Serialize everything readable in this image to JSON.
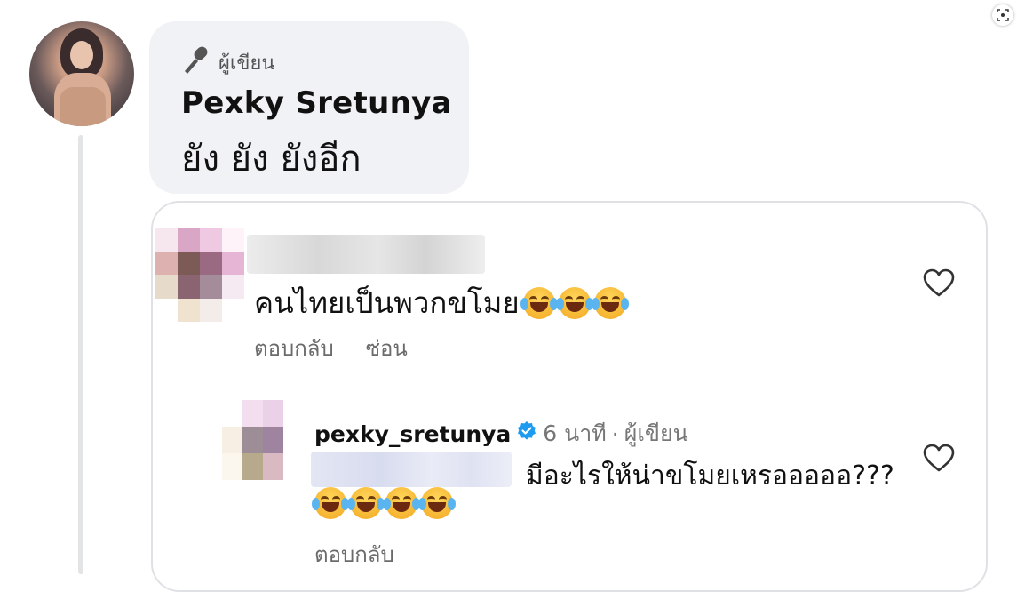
{
  "post": {
    "author_badge": "ผู้เขียน",
    "author_name": "Pexky Sretunya",
    "text": "ยัง ยัง ยังอีก"
  },
  "comment": {
    "text": "คนไทยเป็นพวกขโมย",
    "emoji_count": 3,
    "actions": {
      "reply": "ตอบกลับ",
      "hide": "ซ่อน"
    }
  },
  "reply": {
    "username": "pexky_sretunya",
    "time": "6 นาที",
    "separator": "·",
    "badge": "ผู้เขียน",
    "text": "มีอะไรให้น่าขโมยเหรอออออ???",
    "emoji_count": 4,
    "actions": {
      "reply": "ตอบกลับ"
    }
  },
  "icons": {
    "screenshot": "screenshot-scan-icon",
    "author": "microphone-icon",
    "verified": "verified-badge-icon",
    "like": "heart-outline-icon",
    "emoji": "face-with-tears-of-joy-emoji"
  },
  "colors": {
    "bubble": "#f0f2f5",
    "verified": "#1d9bf0",
    "muted": "#6b6b6b"
  }
}
